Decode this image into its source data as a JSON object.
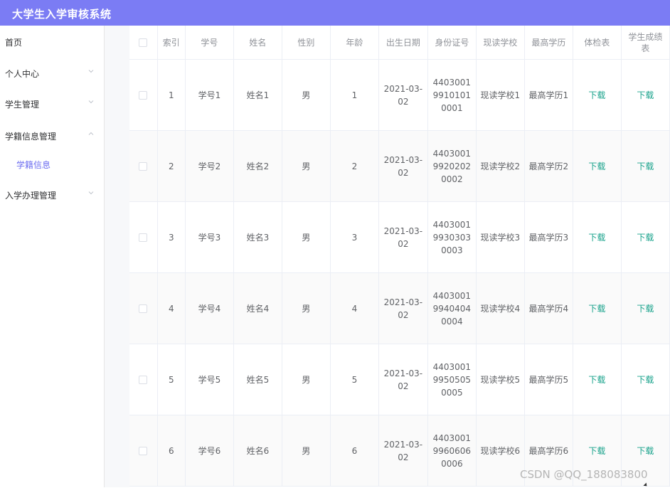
{
  "header": {
    "title": "大学生入学审核系统"
  },
  "sidebar": {
    "items": [
      {
        "label": "首页",
        "has_chevron": false,
        "expanded": false
      },
      {
        "label": "个人中心",
        "has_chevron": true,
        "expanded": false
      },
      {
        "label": "学生管理",
        "has_chevron": true,
        "expanded": false
      },
      {
        "label": "学籍信息管理",
        "has_chevron": true,
        "expanded": true
      },
      {
        "label": "学籍信息",
        "sub": true
      },
      {
        "label": "入学办理管理",
        "has_chevron": true,
        "expanded": false
      }
    ]
  },
  "table": {
    "columns": [
      "",
      "索引",
      "学号",
      "姓名",
      "性别",
      "年龄",
      "出生日期",
      "身份证号",
      "现读学校",
      "最高学历",
      "体检表",
      "学生成绩表"
    ],
    "rows": [
      {
        "index": "1",
        "student_id": "学号1",
        "name": "姓名1",
        "gender": "男",
        "age": "1",
        "birth": "2021-03-02",
        "id_number": "440300199101010001",
        "school": "现读学校1",
        "education": "最高学历1",
        "exam": "下载",
        "grades": "下载"
      },
      {
        "index": "2",
        "student_id": "学号2",
        "name": "姓名2",
        "gender": "男",
        "age": "2",
        "birth": "2021-03-02",
        "id_number": "440300199202020002",
        "school": "现读学校2",
        "education": "最高学历2",
        "exam": "下载",
        "grades": "下载"
      },
      {
        "index": "3",
        "student_id": "学号3",
        "name": "姓名3",
        "gender": "男",
        "age": "3",
        "birth": "2021-03-02",
        "id_number": "440300199303030003",
        "school": "现读学校3",
        "education": "最高学历3",
        "exam": "下载",
        "grades": "下载"
      },
      {
        "index": "4",
        "student_id": "学号4",
        "name": "姓名4",
        "gender": "男",
        "age": "4",
        "birth": "2021-03-02",
        "id_number": "440300199404040004",
        "school": "现读学校4",
        "education": "最高学历4",
        "exam": "下载",
        "grades": "下载"
      },
      {
        "index": "5",
        "student_id": "学号5",
        "name": "姓名5",
        "gender": "男",
        "age": "5",
        "birth": "2021-03-02",
        "id_number": "440300199505050005",
        "school": "现读学校5",
        "education": "最高学历5",
        "exam": "下载",
        "grades": "下载"
      },
      {
        "index": "6",
        "student_id": "学号6",
        "name": "姓名6",
        "gender": "男",
        "age": "6",
        "birth": "2021-03-02",
        "id_number": "440300199606060006",
        "school": "现读学校6",
        "education": "最高学历6",
        "exam": "下载",
        "grades": "下载"
      }
    ]
  },
  "watermark": "CSDN @QQ_188083800",
  "colors": {
    "header_bg": "#7b7cf4",
    "link": "#1aa38c",
    "active_sub": "#6d6ef0"
  }
}
